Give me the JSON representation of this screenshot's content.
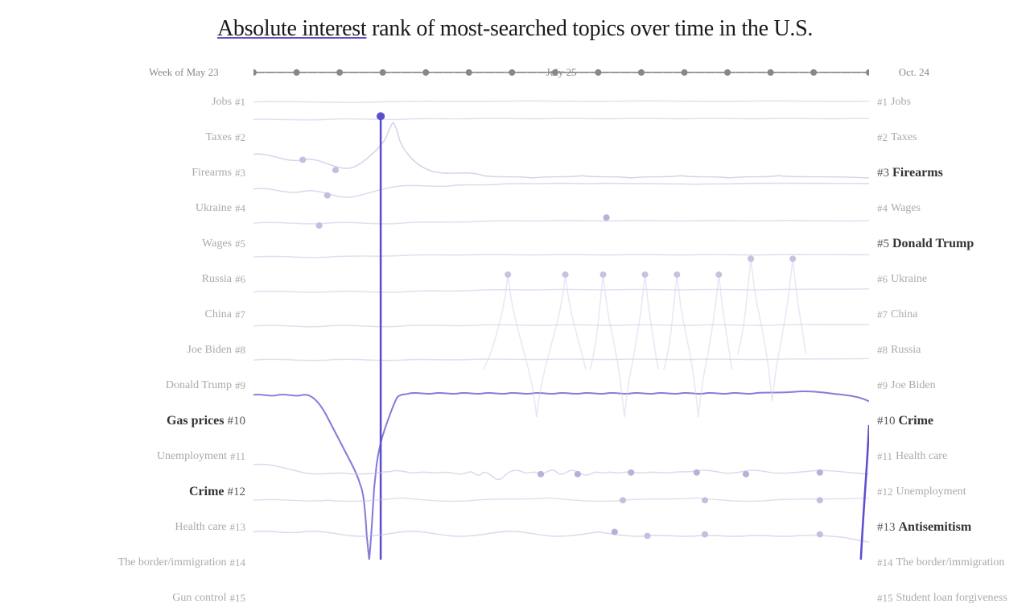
{
  "title": {
    "part1": "Absolute interest",
    "part2": " rank of most-searched topics over time in the U.S."
  },
  "timeline": {
    "left": "Week of May 23",
    "mid": "July 25",
    "right": "Oct. 24"
  },
  "leftLabels": [
    {
      "rank": "#1",
      "topic": "Jobs",
      "highlighted": false
    },
    {
      "rank": "#2",
      "topic": "Taxes",
      "highlighted": false
    },
    {
      "rank": "#3",
      "topic": "Firearms",
      "highlighted": false
    },
    {
      "rank": "#4",
      "topic": "Ukraine",
      "highlighted": false
    },
    {
      "rank": "#5",
      "topic": "Wages",
      "highlighted": false
    },
    {
      "rank": "#6",
      "topic": "Russia",
      "highlighted": false
    },
    {
      "rank": "#7",
      "topic": "China",
      "highlighted": false
    },
    {
      "rank": "#8",
      "topic": "Joe Biden",
      "highlighted": false
    },
    {
      "rank": "#9",
      "topic": "Donald Trump",
      "highlighted": false
    },
    {
      "rank": "#10",
      "topic": "Gas prices",
      "highlighted": true
    },
    {
      "rank": "#11",
      "topic": "Unemployment",
      "highlighted": false
    },
    {
      "rank": "#12",
      "topic": "Crime",
      "highlighted": true
    },
    {
      "rank": "#13",
      "topic": "Health care",
      "highlighted": false
    },
    {
      "rank": "#14",
      "topic": "The border/immigration",
      "highlighted": false
    },
    {
      "rank": "#15",
      "topic": "Gun control",
      "highlighted": false
    }
  ],
  "rightLabels": [
    {
      "rank": "#1",
      "topic": "Jobs",
      "highlighted": false
    },
    {
      "rank": "#2",
      "topic": "Taxes",
      "highlighted": false
    },
    {
      "rank": "#3",
      "topic": "Firearms",
      "highlighted": true
    },
    {
      "rank": "#4",
      "topic": "Wages",
      "highlighted": false
    },
    {
      "rank": "#5",
      "topic": "Donald Trump",
      "highlighted": true
    },
    {
      "rank": "#6",
      "topic": "Ukraine",
      "highlighted": false
    },
    {
      "rank": "#7",
      "topic": "China",
      "highlighted": false
    },
    {
      "rank": "#8",
      "topic": "Russia",
      "highlighted": false
    },
    {
      "rank": "#9",
      "topic": "Joe Biden",
      "highlighted": false
    },
    {
      "rank": "#10",
      "topic": "Crime",
      "highlighted": true
    },
    {
      "rank": "#11",
      "topic": "Health care",
      "highlighted": false
    },
    {
      "rank": "#12",
      "topic": "Unemployment",
      "highlighted": false
    },
    {
      "rank": "#13",
      "topic": "Antisemitism",
      "highlighted": true
    },
    {
      "rank": "#14",
      "topic": "The border/immigration",
      "highlighted": false
    },
    {
      "rank": "#15",
      "topic": "Student loan forgiveness",
      "highlighted": false
    }
  ]
}
